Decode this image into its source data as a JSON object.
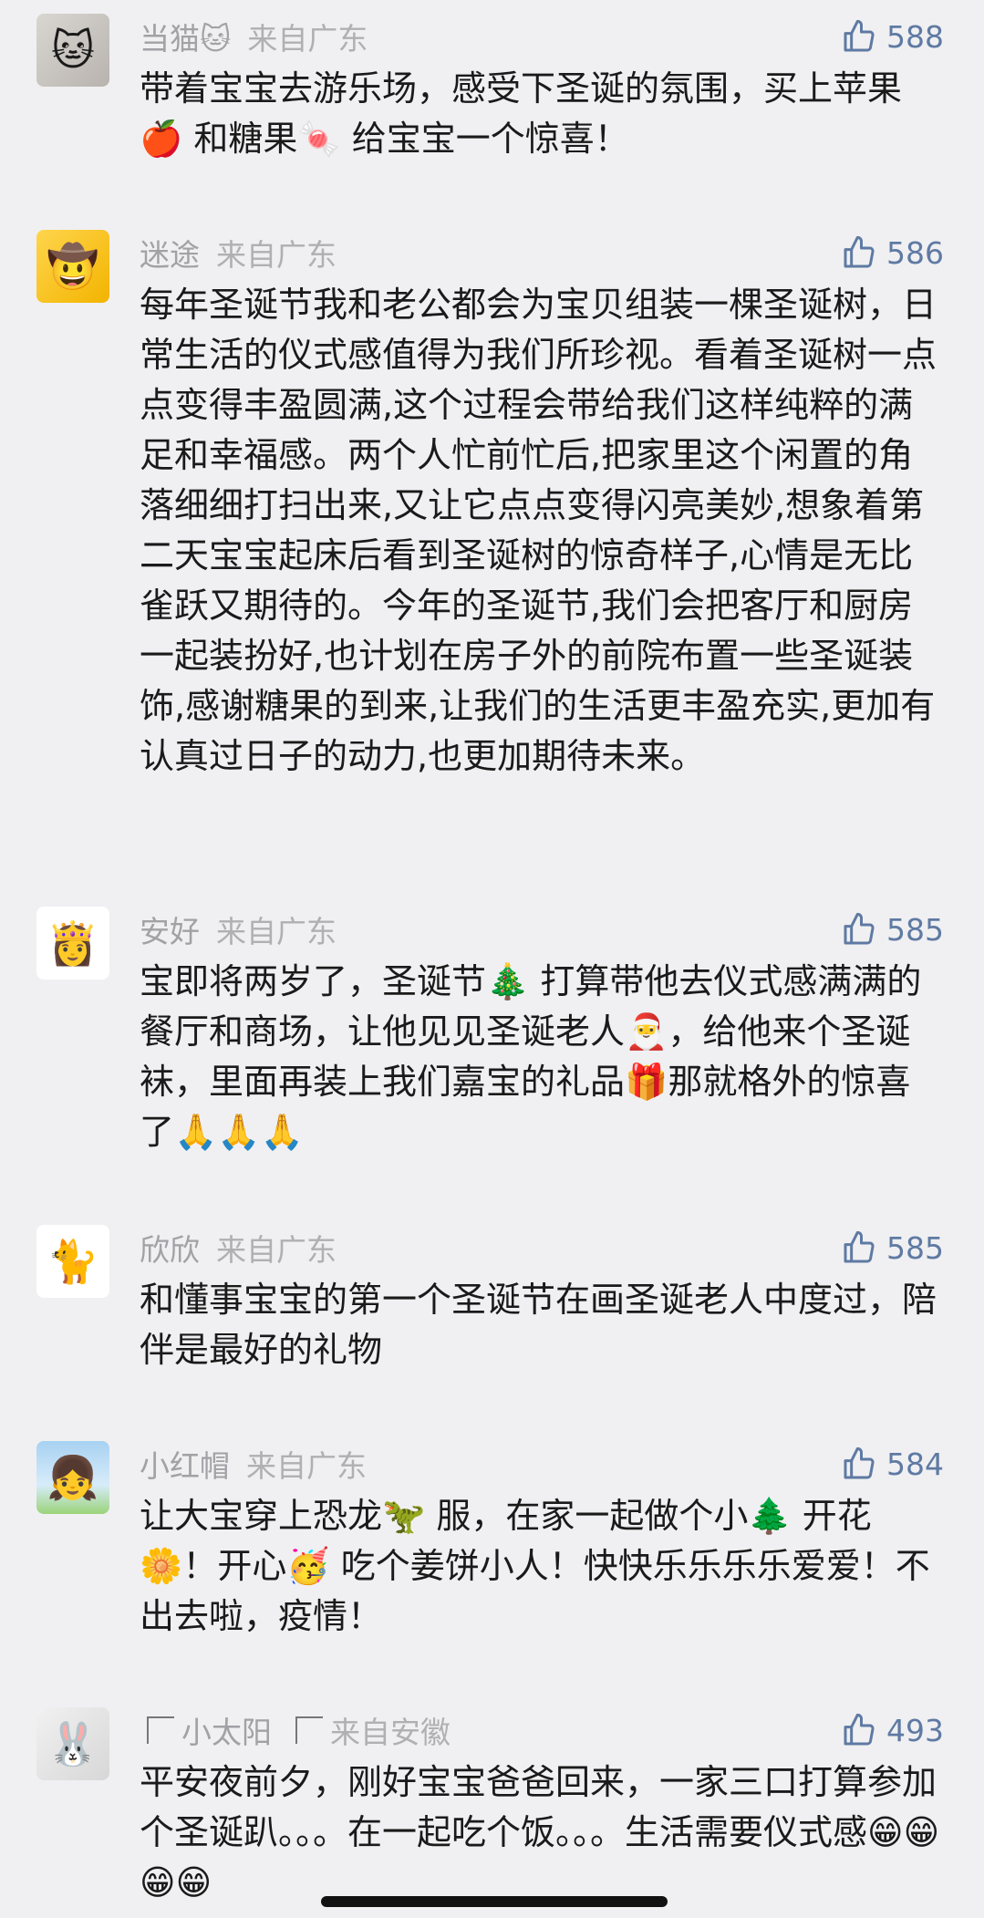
{
  "comments": [
    {
      "nickname": "当猫🐱",
      "location": "来自广东",
      "likes": "588",
      "avatar_icon": "cat-avatar-icon",
      "text": "带着宝宝去游乐场，感受下圣诞的氛围，买上苹果🍎 和糖果🍬 给宝宝一个惊喜！"
    },
    {
      "nickname": "迷途",
      "location": "来自广东",
      "likes": "586",
      "avatar_icon": "kids-avatar-icon",
      "text": "每年圣诞节我和老公都会为宝贝组装一棵圣诞树，日常生活的仪式感值得为我们所珍视。看着圣诞树一点点变得丰盈圆满,这个过程会带给我们这样纯粹的满足和幸福感。两个人忙前忙后,把家里这个闲置的角落细细打扫出来,又让它点点变得闪亮美妙,想象着第二天宝宝起床后看到圣诞树的惊奇样子,心情是无比雀跃又期待的。今年的圣诞节,我们会把客厅和厨房一起装扮好,也计划在房子外的前院布置一些圣诞装饰,感谢糖果的到来,让我们的生活更丰盈充实,更加有认真过日子的动力,也更加期待未来。"
    },
    {
      "nickname": "安好",
      "location": "来自广东",
      "likes": "585",
      "avatar_icon": "princess-avatar-icon",
      "text": "宝即将两岁了，圣诞节🎄 打算带他去仪式感满满的餐厅和商场，让他见见圣诞老人🎅，给他来个圣诞袜，里面再装上我们嘉宝的礼品🎁那就格外的惊喜了🙏🙏🙏"
    },
    {
      "nickname": "欣欣",
      "location": "来自广东",
      "likes": "585",
      "avatar_icon": "hello-kitty-avatar-icon",
      "text": "和懂事宝宝的第一个圣诞节在画圣诞老人中度过，陪伴是最好的礼物"
    },
    {
      "nickname": "小红帽",
      "location": "来自广东",
      "likes": "584",
      "avatar_icon": "red-hood-avatar-icon",
      "text": "让大宝穿上恐龙🦖 服，在家一起做个小🌲 开花🌼！开心🥳 吃个姜饼小人！快快乐乐乐乐爱爱！不出去啦，疫情！"
    },
    {
      "nickname": "小太阳",
      "location": "来自安徽",
      "likes": "493",
      "avatar_icon": "rabbit-avatar-icon",
      "text": "平安夜前夕，刚好宝宝爸爸回来，一家三口打算参加个圣诞趴。。。在一起吃个饭。。。生活需要仪式感😁😁😁😁"
    }
  ],
  "colors": {
    "background": "#f0f0f2",
    "meta_text": "#a1a1a6",
    "like_blue": "#5f7aa3",
    "body_text": "#1a1a1a"
  },
  "icons": {
    "like": "thumbs-up-icon"
  }
}
